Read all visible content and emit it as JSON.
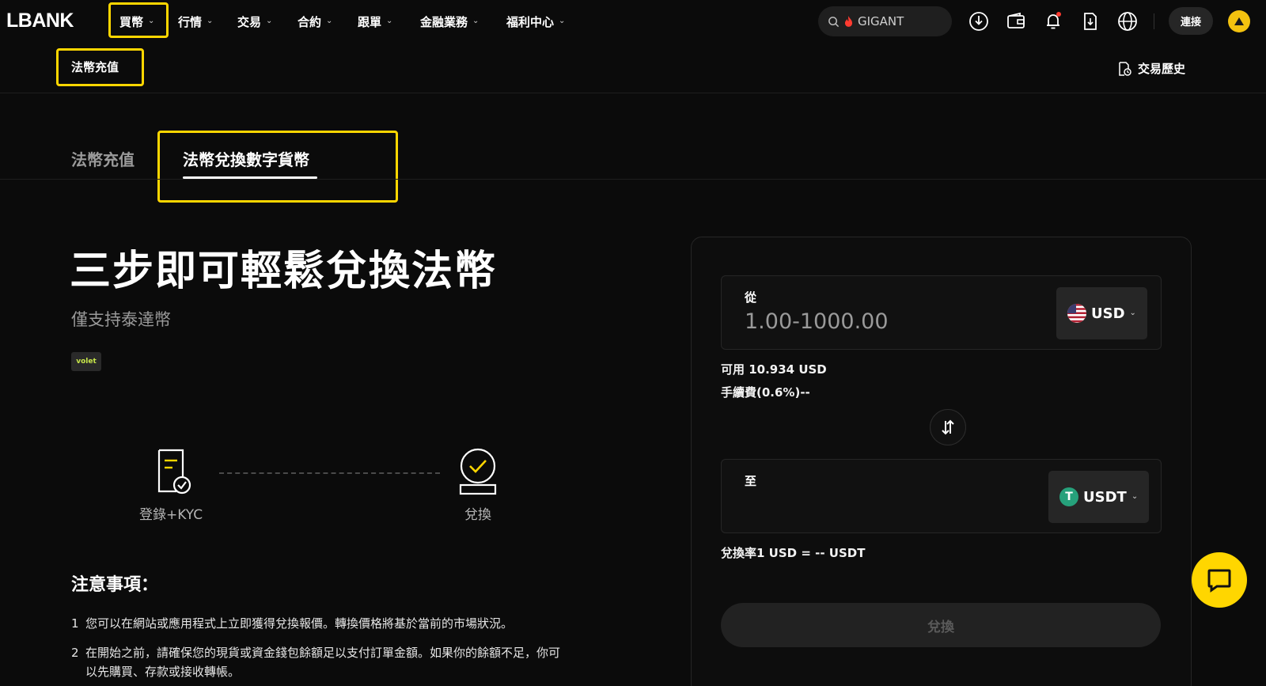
{
  "brand": {
    "logo_text": "LBANK"
  },
  "nav": {
    "items": [
      {
        "label": "買幣"
      },
      {
        "label": "行情"
      },
      {
        "label": "交易"
      },
      {
        "label": "合約"
      },
      {
        "label": "跟單"
      },
      {
        "label": "金融業務"
      },
      {
        "label": "福利中心"
      }
    ],
    "search": {
      "value": "GIGANT",
      "icon": "search-icon",
      "hot_icon": "flame-icon"
    },
    "icons": [
      "download-icon",
      "wallet-icon",
      "bell-icon",
      "document-download-icon",
      "globe-icon"
    ],
    "connect_label": "連接",
    "highlight_color": "#ffd600"
  },
  "subnav": {
    "item_label": "法幣充值",
    "history_label": "交易歷史"
  },
  "tabs": [
    {
      "label": "法幣充值",
      "active": false
    },
    {
      "label": "法幣兌換數字貨幣",
      "active": true
    }
  ],
  "hero": {
    "title": "三步即可輕鬆兌換法幣",
    "subtitle": "僅支持泰達幣",
    "partner_badge": "volet"
  },
  "steps": [
    {
      "label": "登錄+KYC",
      "icon": "document-check-icon"
    },
    {
      "label": "兌換",
      "icon": "badge-check-icon"
    }
  ],
  "notes": {
    "title": "注意事項：",
    "items": [
      {
        "num": "1",
        "text": "您可以在網站或應用程式上立即獲得兌換報價。轉換價格將基於當前的市場狀況。"
      },
      {
        "num": "2",
        "text": "在開始之前，請確保您的現貨或資金錢包餘額足以支付訂單金額。如果你的餘額不足，你可以先購買、存款或接收轉帳。"
      }
    ]
  },
  "exchange": {
    "from": {
      "label": "從",
      "placeholder": "1.00-1000.00",
      "currency": "USD"
    },
    "available": "可用 10.934 USD",
    "fee": "手續費(0.6%)--",
    "to": {
      "label": "至",
      "currency": "USDT",
      "value": ""
    },
    "rate": "兌換率1 USD = -- USDT",
    "submit_label": "兌換",
    "usdt_symbol": "T"
  },
  "colors": {
    "background": "#0b0b0b",
    "accent_yellow": "#ffd600",
    "usdt_green": "#26a17b"
  }
}
